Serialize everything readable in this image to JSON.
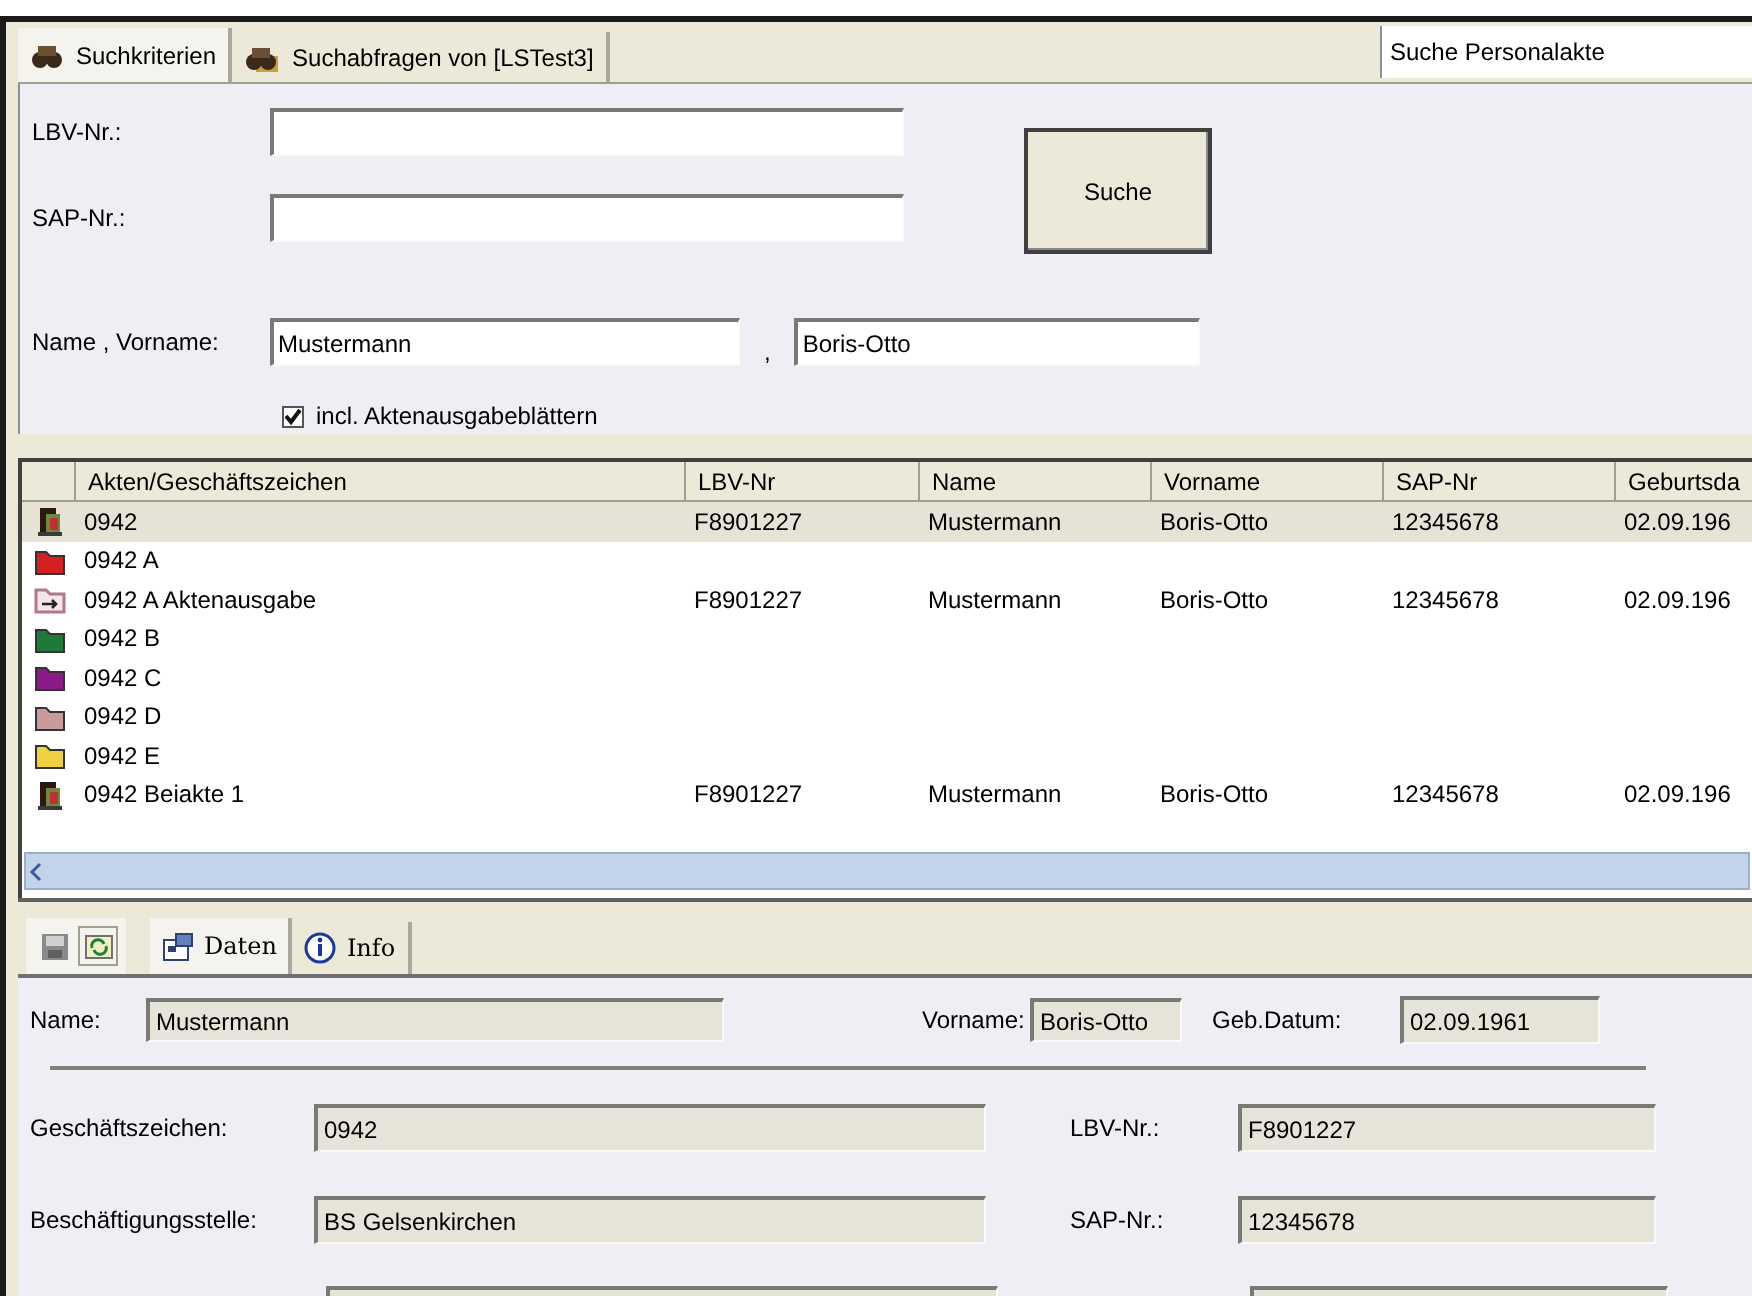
{
  "top_tabs": [
    {
      "label": "Suchkriterien",
      "selected": true,
      "kind": "binoculars"
    },
    {
      "label": "Suchabfragen von [LSTest3]",
      "selected": false,
      "kind": "binoculars-folder"
    }
  ],
  "mode_field": {
    "value": "Suche Personalakte"
  },
  "search_form": {
    "lbv": {
      "label": "LBV-Nr.:"
    },
    "sap": {
      "label": "SAP-Nr.:"
    },
    "button": "Suche",
    "name": {
      "label": "Name , Vorname:",
      "value": "Mustermann",
      "separator": ",",
      "vorname_value": "Boris-Otto"
    },
    "checkbox": {
      "label": "incl. Aktenausgabeblättern",
      "checked": true
    }
  },
  "table": {
    "columns": [
      "Akten/Geschäftszeichen",
      "LBV-Nr",
      "Name",
      "Vorname",
      "SAP-Nr",
      "Geburtsda"
    ],
    "rows": [
      {
        "kind": "record",
        "selected": true,
        "cells": [
          "0942",
          "F8901227",
          "Mustermann",
          "Boris-Otto",
          "12345678",
          "02.09.196"
        ]
      },
      {
        "kind": "folder",
        "color": "#d42020",
        "selected": false,
        "cells": [
          "0942 A"
        ]
      },
      {
        "kind": "folder-out",
        "color": "#b07888",
        "selected": false,
        "cells": [
          "0942 A Aktenausgabe",
          "F8901227",
          "Mustermann",
          "Boris-Otto",
          "12345678",
          "02.09.196"
        ]
      },
      {
        "kind": "folder",
        "color": "#1f7a3a",
        "selected": false,
        "cells": [
          "0942 B"
        ]
      },
      {
        "kind": "folder",
        "color": "#8a1a8a",
        "selected": false,
        "cells": [
          "0942 C"
        ]
      },
      {
        "kind": "folder",
        "color": "#c99a9a",
        "selected": false,
        "cells": [
          "0942 D"
        ]
      },
      {
        "kind": "folder",
        "color": "#f0d040",
        "selected": false,
        "cells": [
          "0942 E"
        ]
      },
      {
        "kind": "record",
        "selected": false,
        "cells": [
          "0942 Beiakte 1",
          "F8901227",
          "Mustermann",
          "Boris-Otto",
          "12345678",
          "02.09.196"
        ]
      }
    ]
  },
  "detail_tabs": [
    {
      "label": "Daten",
      "selected": true,
      "kind": "form"
    },
    {
      "label": "Info",
      "selected": false,
      "kind": "info"
    }
  ],
  "detail": {
    "name": {
      "label": "Name:",
      "value": "Mustermann"
    },
    "vorname": {
      "label": "Vorname:",
      "value": "Boris-Otto"
    },
    "geb_datum": {
      "label": "Geb.Datum:",
      "value": "02.09.1961"
    },
    "geschaeftszeichen": {
      "label": "Geschäftszeichen:",
      "value": "0942"
    },
    "lbv_nr": {
      "label": "LBV-Nr.:",
      "value": "F8901227"
    },
    "beschaeftigungsstelle": {
      "label": "Beschäftigungsstelle:",
      "value": "BS Gelsenkirchen"
    },
    "sap_nr": {
      "label": "SAP-Nr.:",
      "value": "12345678"
    }
  }
}
